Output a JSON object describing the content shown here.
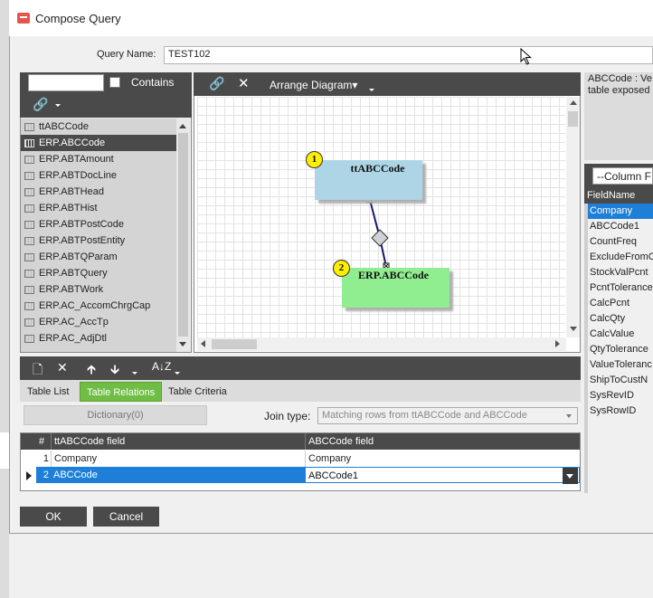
{
  "window": {
    "title": "Compose Query"
  },
  "query": {
    "label": "Query Name:",
    "value": "TEST102"
  },
  "table_browser": {
    "contains_label": "Contains",
    "search_value": "",
    "tables": [
      "ttABCCode",
      "ERP.ABCCode",
      "ERP.ABTAmount",
      "ERP.ABTDocLine",
      "ERP.ABTHead",
      "ERP.ABTHist",
      "ERP.ABTPostCode",
      "ERP.ABTPostEntity",
      "ERP.ABTQParam",
      "ERP.ABTQuery",
      "ERP.ABTWork",
      "ERP.AC_AccomChrgCap",
      "ERP.AC_AccTp",
      "ERP.AC_AdjDtl"
    ],
    "selected_index": 1
  },
  "diagram": {
    "arrange_label": "Arrange Diagram",
    "nodes": [
      {
        "badge": "1",
        "name": "ttABCCode",
        "color": "#aed5e6"
      },
      {
        "badge": "2",
        "name": "ERP.ABCCode",
        "color": "#90ee90"
      }
    ]
  },
  "right_panel": {
    "info_line1": "ABCCode : Ve",
    "info_line2": "table exposed",
    "column_select": "--Column F",
    "header": "FieldName",
    "fields": [
      "Company",
      "ABCCode1",
      "CountFreq",
      "ExcludeFromC",
      "StockValPcnt",
      "PcntTolerance",
      "CalcPcnt",
      "CalcQty",
      "CalcValue",
      "QtyTolerance",
      "ValueToleranc",
      "ShipToCustN",
      "SysRevID",
      "SysRowID"
    ],
    "selected_index": 0
  },
  "bottom": {
    "tabs": [
      "Table List",
      "Table Relations",
      "Table Criteria"
    ],
    "active_tab": 1,
    "dictionary_label": "Dictionary(0)",
    "join_label": "Join type:",
    "join_value": "Matching rows from ttABCCode and ABCCode",
    "grid": {
      "headers": [
        "#",
        "ttABCCode field",
        "ABCCode field"
      ],
      "rows": [
        {
          "num": "1",
          "left": "Company",
          "right": "Company"
        },
        {
          "num": "2",
          "left": "ABCCode",
          "right": "ABCCode1"
        }
      ]
    }
  },
  "buttons": {
    "ok": "OK",
    "cancel": "Cancel"
  },
  "colors": {
    "accent_green": "#6fbd44",
    "selection_blue": "#1e7fd8",
    "toolbar_dark": "#4a4a4a"
  }
}
